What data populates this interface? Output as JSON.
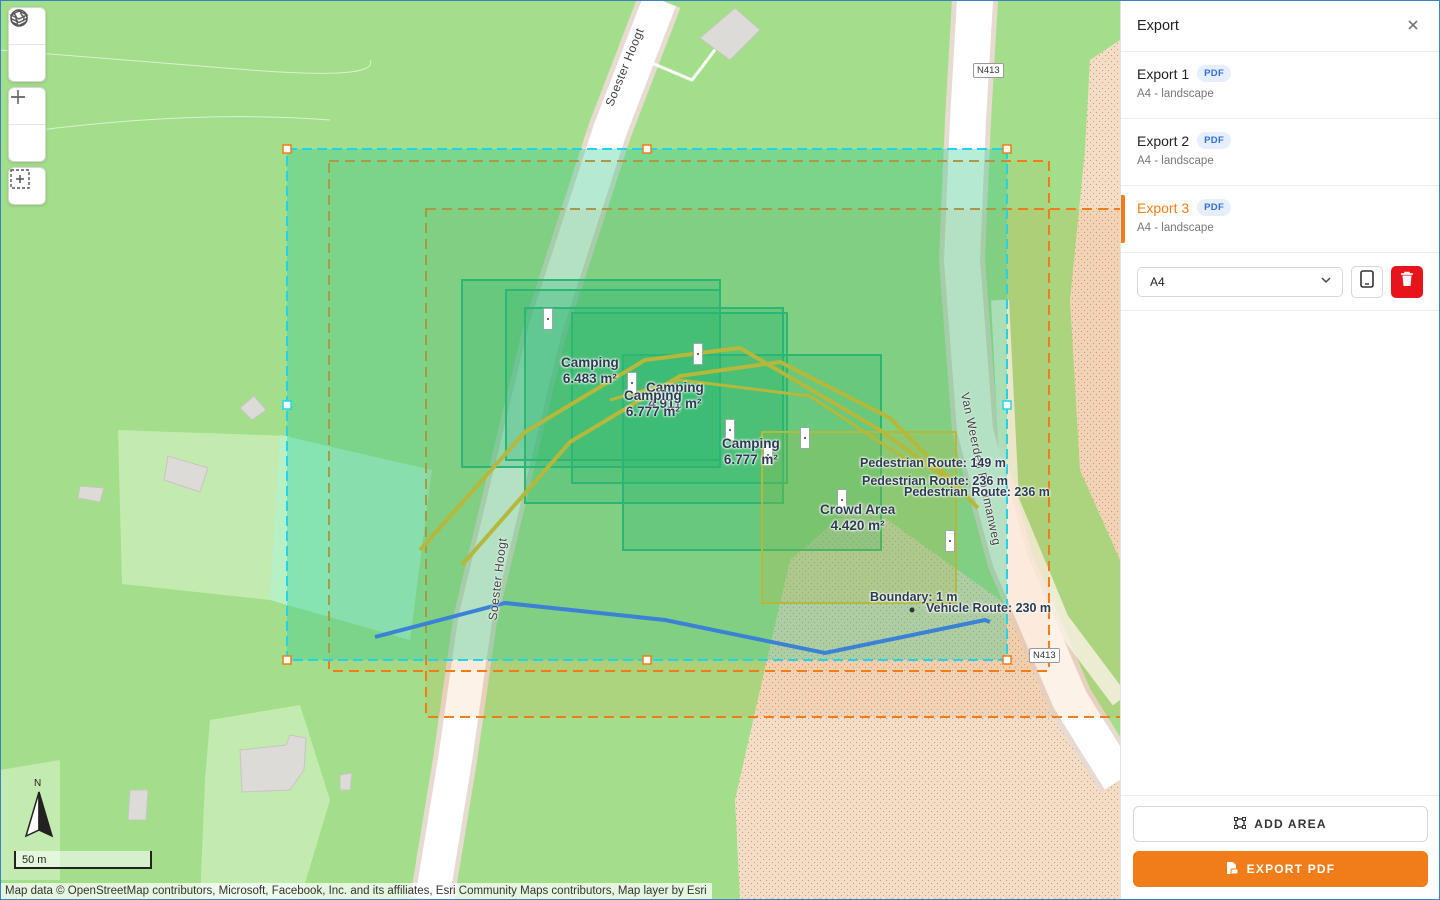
{
  "map": {
    "controls": {
      "basemap": "globe-icon",
      "layers": "layers-icon",
      "zoom_in": "plus-icon",
      "zoom_out": "minus-icon",
      "select_area": "select-area-icon"
    },
    "scale_label": "50 m",
    "north_label": "N",
    "attribution": "Map data © OpenStreetMap contributors, Microsoft, Facebook, Inc. and its affiliates, Esri Community Maps contributors, Map layer by Esri",
    "road_labels": {
      "soester_hoogt_top": "Soester Hoogt",
      "soester_hoogt_bottom": "Soester Hoogt",
      "van_weerden": "Van Weerden Poelmanweg",
      "shield_top": "N413",
      "shield_bottom": "N413"
    },
    "feature_labels": {
      "camping_1": "Camping\n6.483 m²",
      "camping_2": "Camping\n4.911 m²",
      "camping_3": "Camping\n6.777 m²",
      "camping_4": "Camping\n6.777 m²",
      "ped_route_1": "Pedestrian Route: 149 m",
      "ped_route_2": "Pedestrian Route: 236 m",
      "ped_route_3": "Pedestrian Route: 236 m",
      "crowd_area": "Crowd Area\n4.420 m²",
      "boundary": "Boundary: 1 m",
      "vehicle_route": "Vehicle Route: 230 m"
    },
    "colors": {
      "grass": "#a3de8a",
      "selection": "#22d3ee",
      "export_frame": "#f07d1a",
      "camping": "#2bb673",
      "pedestrian_route": "#b5b83a",
      "vehicle_route": "#3b82d6"
    }
  },
  "panel": {
    "title": "Export",
    "close_icon": "close-icon",
    "exports": [
      {
        "name": "Export 1",
        "format": "PDF",
        "detail": "A4 - landscape",
        "active": false
      },
      {
        "name": "Export 2",
        "format": "PDF",
        "detail": "A4 - landscape",
        "active": false
      },
      {
        "name": "Export 3",
        "format": "PDF",
        "detail": "A4 - landscape",
        "active": true
      }
    ],
    "paper_size": "A4",
    "orientation_icon": "tablet-portrait-icon",
    "delete_icon": "trash-icon",
    "add_area_label": "ADD AREA",
    "export_label": "EXPORT PDF",
    "accent": "#f07d1a",
    "danger": "#e8141b"
  }
}
